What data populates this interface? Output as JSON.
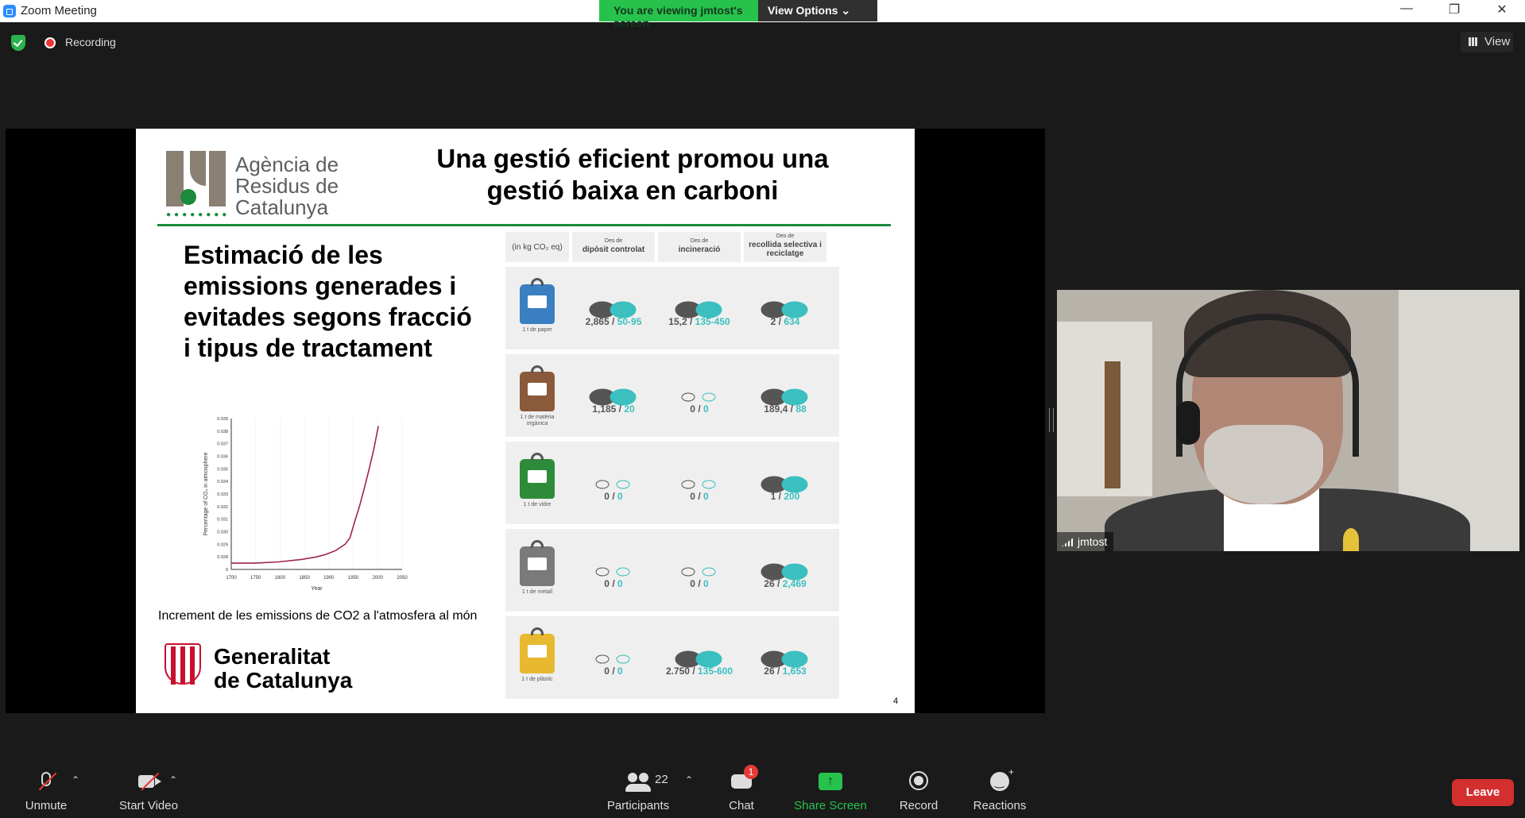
{
  "window": {
    "title": "Zoom Meeting",
    "minimize": "—",
    "restore": "❐",
    "close": "✕"
  },
  "banner": {
    "viewing": "You are viewing jmtost's screen",
    "options": "View Options ⌄"
  },
  "status": {
    "recording": "Recording",
    "view": "View"
  },
  "slide": {
    "agency": [
      "Agència de",
      "Residus de",
      "Catalunya"
    ],
    "title": "Una gestió eficient promou una gestió baixa en carboni",
    "subtitle": "Estimació de les emissions generades i evitades segons fracció i tipus de tractament",
    "caption": "Increment de les emissions de CO2 a l'atmosfera al món",
    "government": [
      "Generalitat",
      "de Catalunya"
    ],
    "page": "4",
    "table": {
      "unit": "(in kg CO₂ eq)",
      "headers": [
        {
          "top": "Des de",
          "main": "dipòsit controlat"
        },
        {
          "top": "Des de",
          "main": "incineració"
        },
        {
          "top": "Des de",
          "main": "recollida selectiva i reciclatge"
        }
      ],
      "rows": [
        {
          "label": "1 t de paper",
          "color": "#3a7fc1",
          "cells": [
            {
              "a": "2,865",
              "b": "50-95"
            },
            {
              "a": "15,2",
              "b": "135-450"
            },
            {
              "a": "2",
              "b": "634"
            }
          ]
        },
        {
          "label": "1 t de matèria orgànica",
          "color": "#8a5a3a",
          "cells": [
            {
              "a": "1,185",
              "b": "20"
            },
            {
              "a": "0",
              "b": "0"
            },
            {
              "a": "189,4",
              "b": "88"
            }
          ]
        },
        {
          "label": "1 t de vidre",
          "color": "#2e8b3a",
          "cells": [
            {
              "a": "0",
              "b": "0"
            },
            {
              "a": "0",
              "b": "0"
            },
            {
              "a": "1",
              "b": "200"
            }
          ]
        },
        {
          "label": "1 t de metall",
          "color": "#7a7a7a",
          "cells": [
            {
              "a": "0",
              "b": "0"
            },
            {
              "a": "0",
              "b": "0"
            },
            {
              "a": "26",
              "b": "2,469"
            }
          ]
        },
        {
          "label": "1 t de plàstic",
          "color": "#e8b930",
          "cells": [
            {
              "a": "0",
              "b": "0"
            },
            {
              "a": "2.750",
              "b": "135-600"
            },
            {
              "a": "26",
              "b": "1,653"
            }
          ]
        }
      ]
    }
  },
  "chart_data": {
    "type": "line",
    "xlabel": "Year",
    "ylabel": "Percentage of CO₂ in atmosphere",
    "x_ticks": [
      "1700",
      "1750",
      "1800",
      "1850",
      "1900",
      "1950",
      "2000",
      "2050"
    ],
    "y_ticks": [
      "0",
      "0.028",
      "0.029",
      "0.030",
      "0.031",
      "0.032",
      "0.033",
      "0.034",
      "0.035",
      "0.036",
      "0.037",
      "0.038",
      "0.039"
    ],
    "x": [
      1700,
      1750,
      1800,
      1850,
      1880,
      1900,
      1920,
      1940,
      1950,
      1960,
      1970,
      1980,
      1990,
      2000,
      2010
    ],
    "y": [
      0.028,
      0.028,
      0.0281,
      0.0283,
      0.0285,
      0.0287,
      0.029,
      0.0295,
      0.03,
      0.0313,
      0.0325,
      0.0339,
      0.0354,
      0.037,
      0.0389
    ],
    "ylim": [
      0.0275,
      0.0395
    ],
    "xlim": [
      1700,
      2060
    ],
    "grid": true,
    "color": "#a0244a"
  },
  "participant": {
    "name": "jmtost"
  },
  "toolbar": {
    "unmute": "Unmute",
    "start_video": "Start Video",
    "participants": "Participants",
    "participant_count": "22",
    "chat": "Chat",
    "chat_badge": "1",
    "share": "Share Screen",
    "record": "Record",
    "reactions": "Reactions",
    "leave": "Leave"
  },
  "colors": {
    "accent_green": "#27c24c",
    "leave_red": "#d32f2f",
    "teal": "#3bbfbf"
  }
}
